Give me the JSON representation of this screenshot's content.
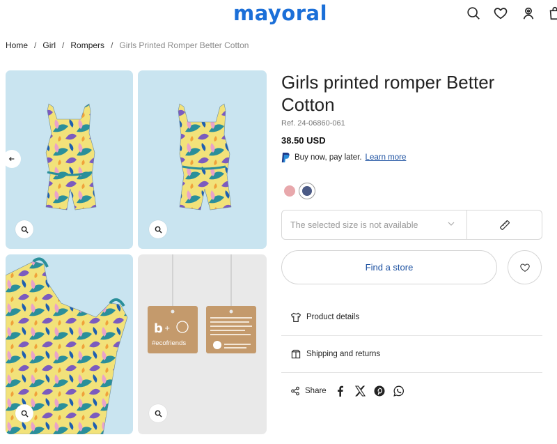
{
  "header": {
    "logo": "mayoral",
    "icons": [
      "search-icon",
      "heart-icon",
      "user-icon",
      "bag-icon"
    ]
  },
  "breadcrumb": {
    "items": [
      "Home",
      "Girl",
      "Rompers"
    ],
    "current": "Girls Printed Romper Better Cotton",
    "separator": "/"
  },
  "product": {
    "title": "Girls printed romper Better Cotton",
    "ref": "Ref. 24-06860-061",
    "price": "38.50 USD",
    "paypal_text": "Buy now, pay later.",
    "paypal_link": "Learn more",
    "colors": [
      "#e8a8ac",
      "#4b5a85"
    ],
    "size_placeholder": "The selected size is not available",
    "find_store": "Find a store",
    "details_label": "Product details",
    "shipping_label": "Shipping and returns",
    "share_label": "Share"
  },
  "gallery": {
    "tag_text": "#ecofriends",
    "colors": {
      "tile_bg": "#c9e4f0",
      "tag_bg": "#e9e9e9",
      "kraft": "#c49a6c"
    }
  },
  "colors": {
    "brand": "#1b6fd8",
    "link": "#1a4fa0"
  }
}
